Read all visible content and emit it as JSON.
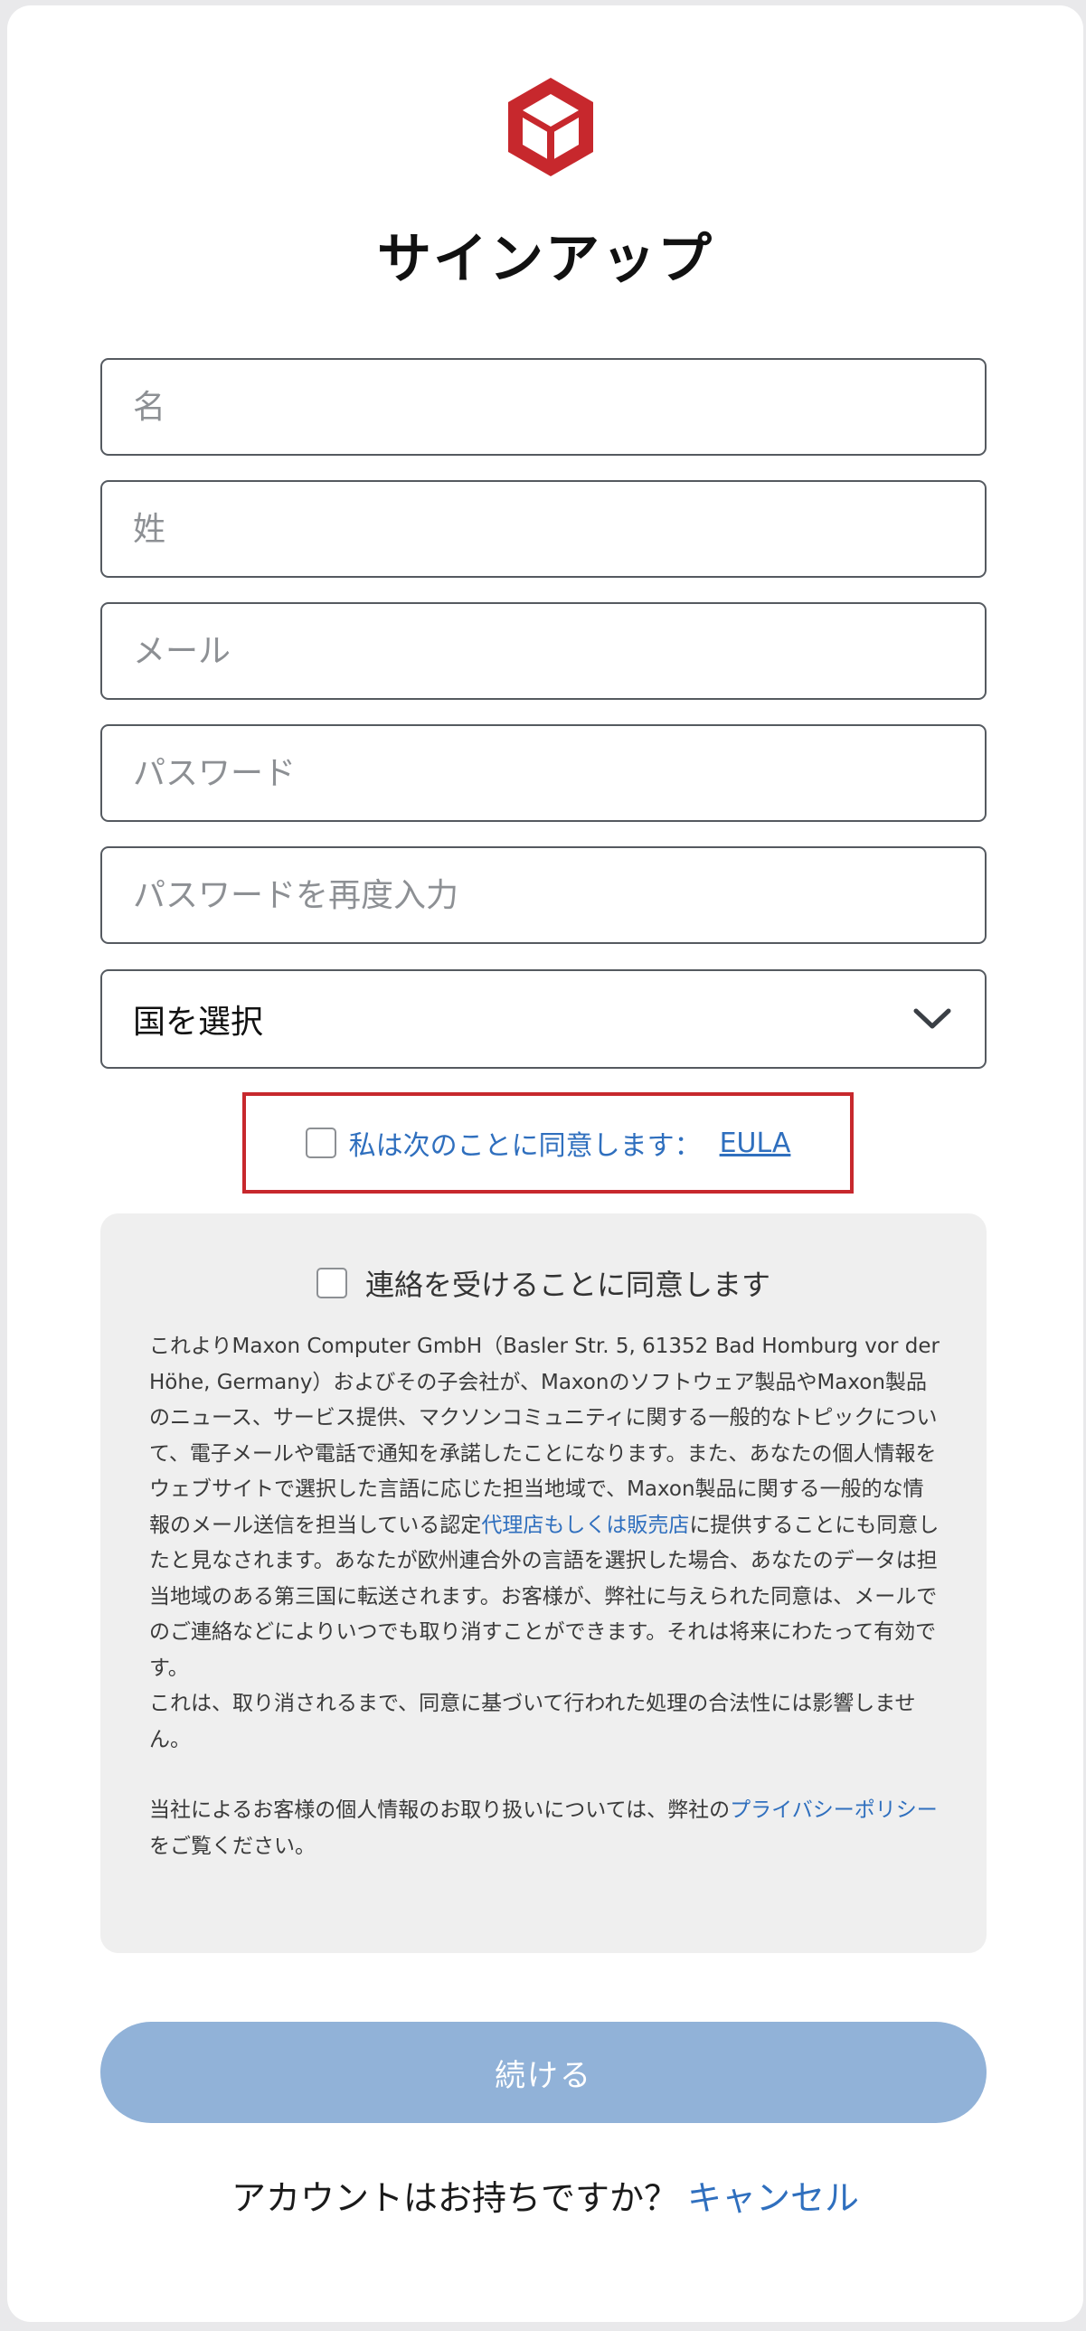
{
  "colors": {
    "brand": "#c7282d",
    "link": "#2f6fbe",
    "button_disabled": "#91b2d8",
    "panel_bg": "#efefef"
  },
  "logo": {
    "icon": "maxon-cube-logo"
  },
  "title": "サインアップ",
  "form": {
    "first_name_placeholder": "名",
    "last_name_placeholder": "姓",
    "email_placeholder": "メール",
    "password_placeholder": "パスワード",
    "password_confirm_placeholder": "パスワードを再度入力",
    "country_select_value": "国を選択",
    "country_select_icon": "chevron-down-icon"
  },
  "eula": {
    "label": "私は次のことに同意します：",
    "link": "EULA",
    "checked": false
  },
  "consent": {
    "checkbox_label": "連絡を受けることに同意します",
    "checked": false,
    "para1_pre": "これよりMaxon Computer GmbH（Basler Str. 5, 61352 Bad Homburg vor der Höhe, Germany）およびその子会社が、Maxonのソフトウェア製品やMaxon製品のニュース、サービス提供、マクソンコミュニティに関する一般的なトピックについて、電子メールや電話で通知を承諾したことになります。また、あなたの個人情報をウェブサイトで選択した言語に応じた担当地域で、Maxon製品に関する一般的な情報のメール送信を担当している認定",
    "para1_link": "代理店もしくは販売店",
    "para1_post": "に提供することにも同意したと見なされます。あなたが欧州連合外の言語を選択した場合、あなたのデータは担当地域のある第三国に転送されます。お客様が、弊社に与えられた同意は、メールでのご連絡などによりいつでも取り消すことができます。それは将来にわたって有効です。",
    "para2": "これは、取り消されるまで、同意に基づいて行われた処理の合法性には影響しません。",
    "para3_pre": "当社によるお客様の個人情報のお取り扱いについては、弊社の",
    "para3_link": "プライバシーポリシー",
    "para3_post": "をご覧ください。"
  },
  "continue_button": "続ける",
  "footer": {
    "question": "アカウントはお持ちですか？",
    "cancel_link": "キャンセル"
  }
}
